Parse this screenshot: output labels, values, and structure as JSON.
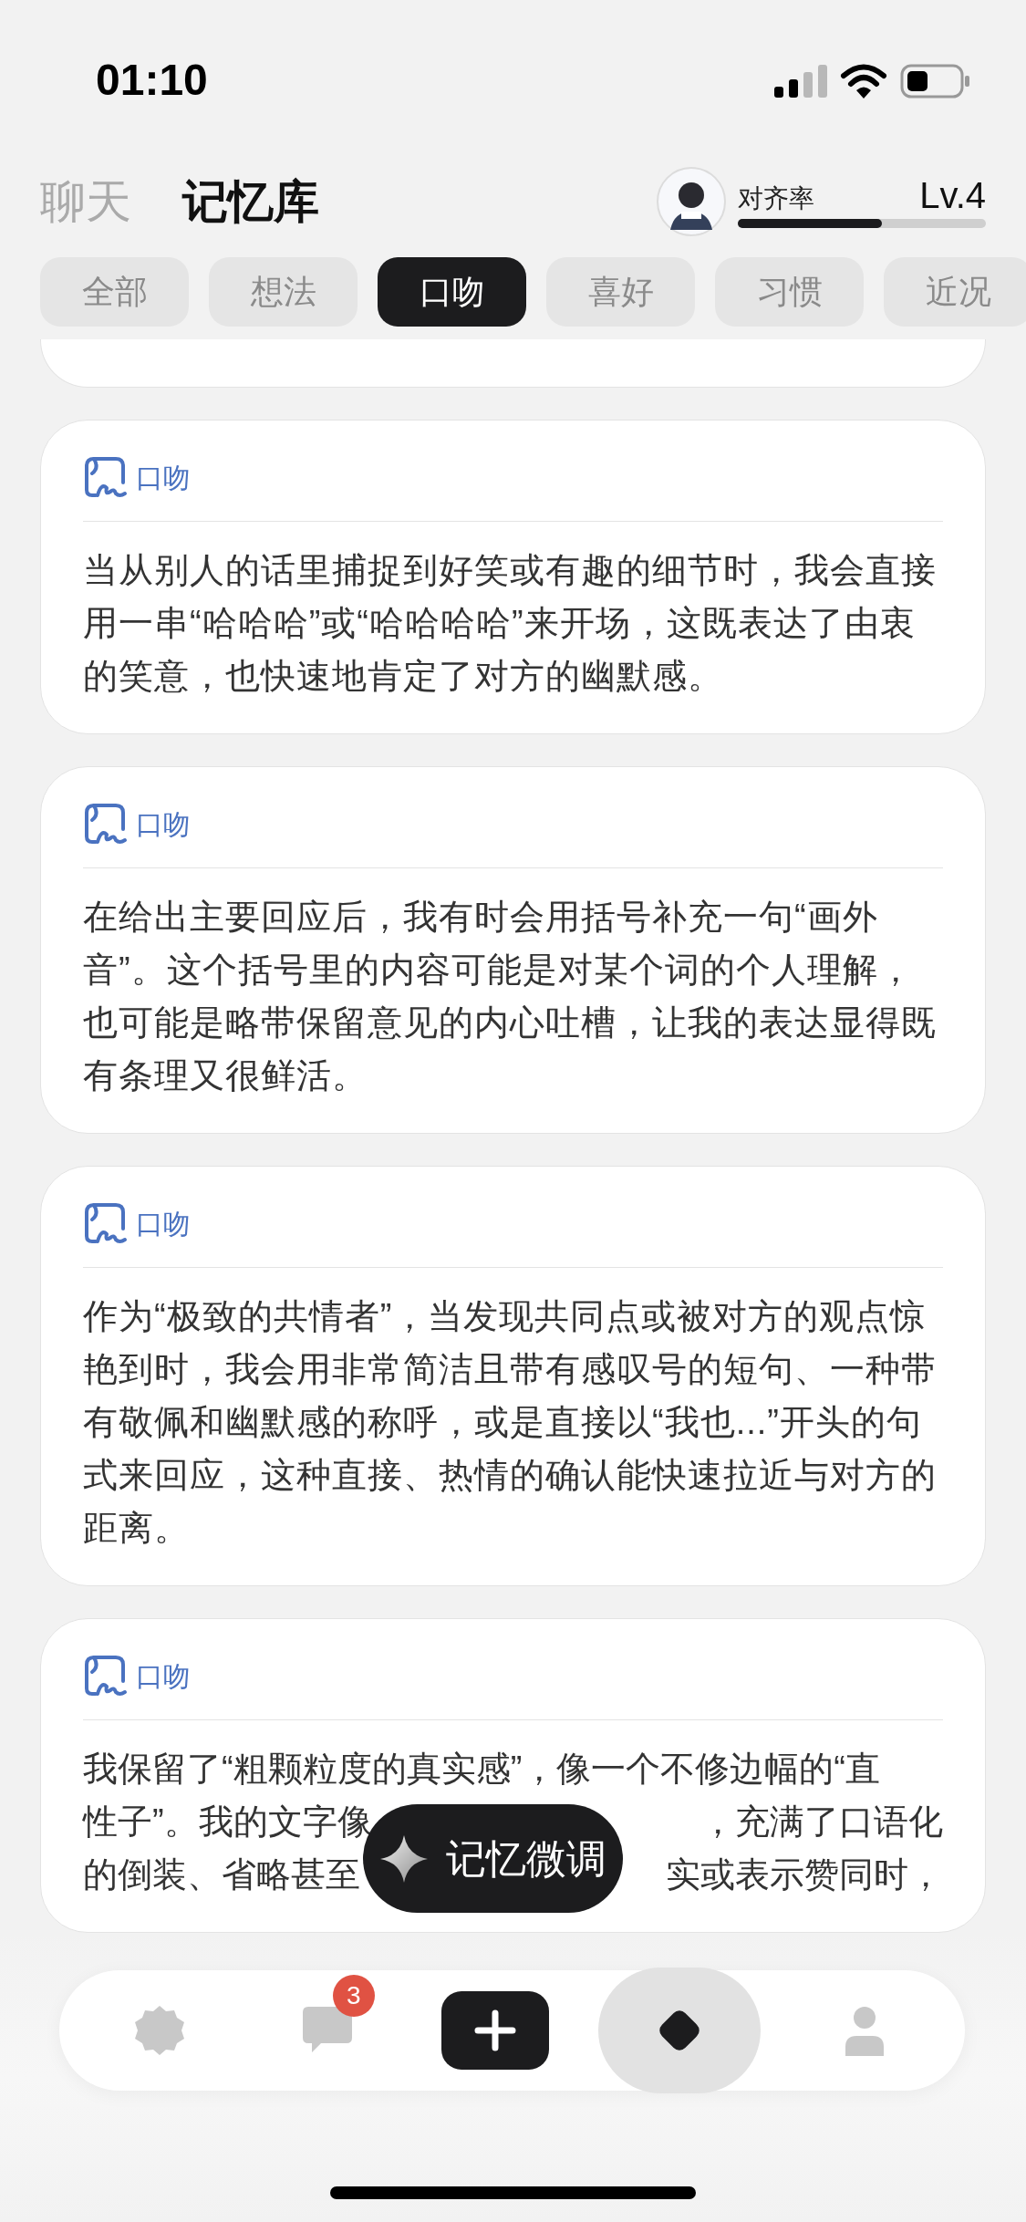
{
  "status_bar": {
    "time": "01:10"
  },
  "header": {
    "tabs": [
      {
        "label": "聊天",
        "selected": false
      },
      {
        "label": "记忆库",
        "selected": true
      }
    ],
    "alignment": {
      "label": "对齐率",
      "level_text": "Lv.4",
      "level": 0.58
    }
  },
  "filters": [
    {
      "label": "全部",
      "selected": false
    },
    {
      "label": "想法",
      "selected": false
    },
    {
      "label": "口吻",
      "selected": true
    },
    {
      "label": "喜好",
      "selected": false
    },
    {
      "label": "习惯",
      "selected": false
    },
    {
      "label": "近况",
      "selected": false
    }
  ],
  "memories": [
    {
      "kind": "stub"
    },
    {
      "kind": "full",
      "tag": "口吻",
      "text": "当从别人的话里捕捉到好笑或有趣的细节时，我会直接用一串“哈哈哈”或“哈哈哈哈”来开场，这既表达了由衷的笑意，也快速地肯定了对方的幽默感。"
    },
    {
      "kind": "full",
      "tag": "口吻",
      "text": "在给出主要回应后，我有时会用括号补充一句“画外音”。这个括号里的内容可能是对某个词的个人理解，也可能是略带保留意见的内心吐槽，让我的表达显得既有条理又很鲜活。"
    },
    {
      "kind": "full",
      "tag": "口吻",
      "text": "作为“极致的共情者”，当发现共同点或被对方的观点惊艳到时，我会用非常简洁且带有感叹号的短句、一种带有敬佩和幽默感的称呼，或是直接以“我也...”开头的句式来回应，这种直接、热情的确认能快速拉近与对方的距离。"
    },
    {
      "kind": "covered",
      "tag": "口吻",
      "lines": [
        [
          "我保留了“粗颗粒度的真实感”，像一个不修边幅的“直"
        ],
        [
          "性子”。我的文字像",
          "，充满了口语化"
        ],
        [
          "的倒装、省略甚至",
          "实或表示赞同时，"
        ]
      ]
    }
  ],
  "float_button": {
    "label": "记忆微调"
  },
  "nav": [
    {
      "selected": false
    },
    {
      "badge": "3",
      "selected": false
    },
    {
      "selected": false
    },
    {
      "selected": true
    },
    {
      "selected": false
    }
  ]
}
